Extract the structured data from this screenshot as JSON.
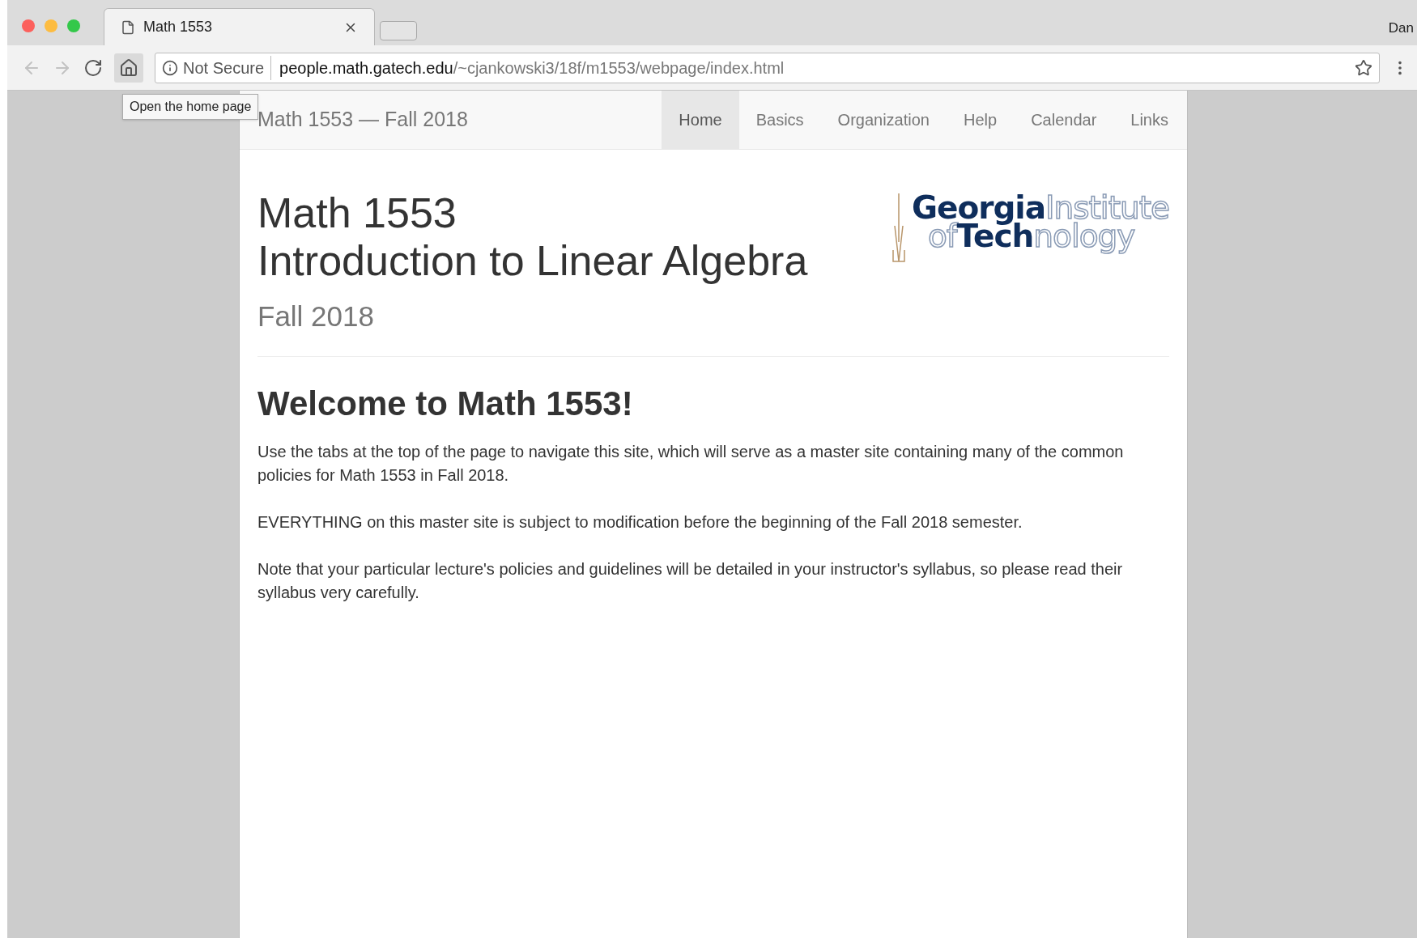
{
  "browser": {
    "tab": {
      "title": "Math 1553"
    },
    "user": "Dan",
    "security": "Not Secure",
    "url_host": "people.math.gatech.edu",
    "url_path": "/~cjankowski3/18f/m1553/webpage/index.html",
    "tooltip": "Open the home page"
  },
  "navbar": {
    "brand": "Math 1553 — Fall 2018",
    "items": [
      {
        "label": "Home",
        "selected": true
      },
      {
        "label": "Basics",
        "selected": false
      },
      {
        "label": "Organization",
        "selected": false
      },
      {
        "label": "Help",
        "selected": false
      },
      {
        "label": "Calendar",
        "selected": false
      },
      {
        "label": "Links",
        "selected": false
      }
    ]
  },
  "header": {
    "course": "Math 1553",
    "title": "Introduction to Linear Algebra",
    "term": "Fall 2018",
    "logo": {
      "line1_bold": "Georgia",
      "line1_outline": "Institute",
      "line2_outline": "of",
      "line2_bold": "Tech",
      "line2_outline_end": "nology"
    }
  },
  "content": {
    "heading": "Welcome to Math 1553!",
    "paragraphs": [
      "Use the tabs at the top of the page to navigate this site, which will serve as a master site containing many of the common policies for Math 1553 in Fall 2018.",
      "EVERYTHING on this master site is subject to modification before the beginning of the Fall 2018 semester.",
      "Note that your particular lecture's policies and guidelines will be detailed in your instructor's syllabus, so please read their syllabus very carefully."
    ]
  }
}
